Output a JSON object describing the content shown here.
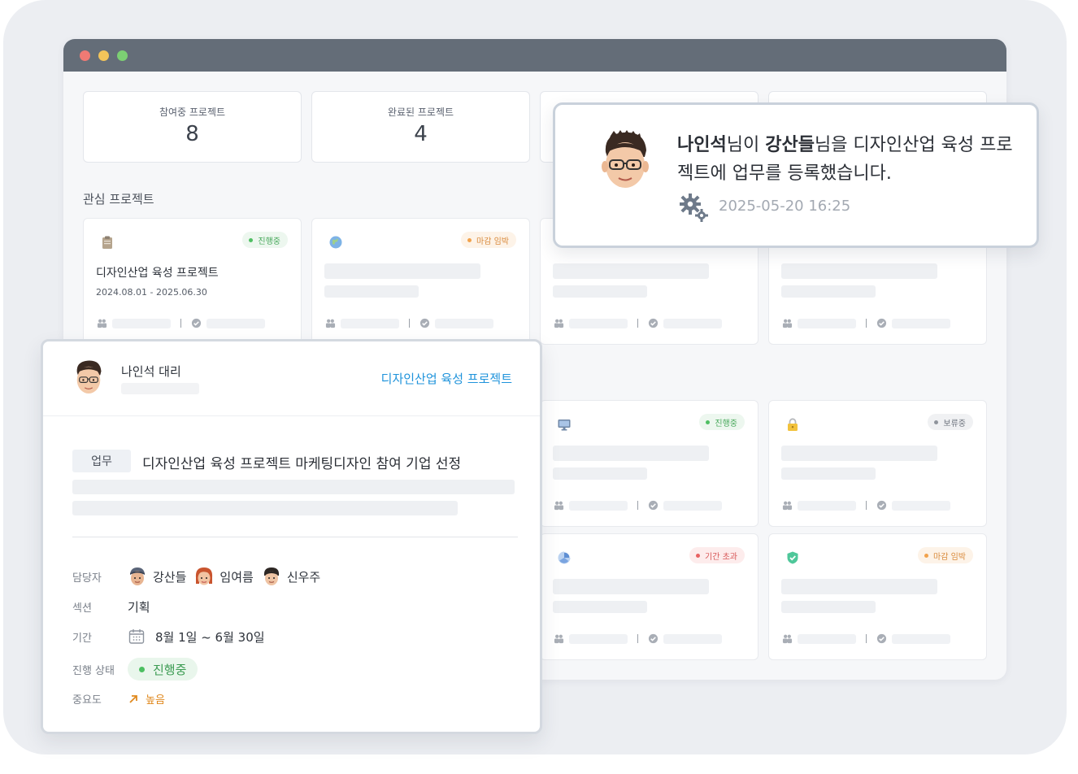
{
  "stats": [
    {
      "label": "참여중 프로젝트",
      "value": "8"
    },
    {
      "label": "완료된 프로젝트",
      "value": "4"
    }
  ],
  "interest_section": {
    "title": "관심 프로젝트"
  },
  "project_cards": [
    {
      "icon": "clipboard-icon",
      "status": "진행중",
      "title": "디자인산업 육성 프로젝트",
      "dates": "2024.08.01 - 2025.06.30"
    },
    {
      "icon": "globe-icon",
      "status": "마감 임박"
    },
    {
      "icon": "monitor-icon",
      "status": "진행중"
    },
    {
      "icon": "lock-icon",
      "status": "보류중"
    },
    {
      "icon": "pie-chart-icon",
      "status": "기간 초과"
    },
    {
      "icon": "shield-check-icon",
      "status": "마감 임박"
    }
  ],
  "notification": {
    "actor": "나인석",
    "actor_suffix": "님이 ",
    "target": "강산들",
    "message_rest": "님을 디자인산업 육성 프로젝트에 업무를 등록했습니다.",
    "timestamp": "2025-05-20 16:25",
    "icon": "gear-icon"
  },
  "task_detail": {
    "author": "나인석 대리",
    "project_link": "디자인산업 육성 프로젝트",
    "tag": "업무",
    "title": "디자인산업 육성 프로젝트 마케팅디자인 참여 기업 선정",
    "labels": {
      "assignee": "담당자",
      "section": "섹션",
      "period": "기간",
      "status": "진행 상태",
      "priority": "중요도"
    },
    "assignees": [
      "강산들",
      "임여름",
      "신우주"
    ],
    "section": "기획",
    "period": "8월 1일 ~ 6월 30일",
    "status": "진행중",
    "priority": "높음"
  },
  "colors": {
    "accent_link": "#1f93db",
    "status_green": "#4cbf61",
    "priority_orange": "#e0891e"
  }
}
